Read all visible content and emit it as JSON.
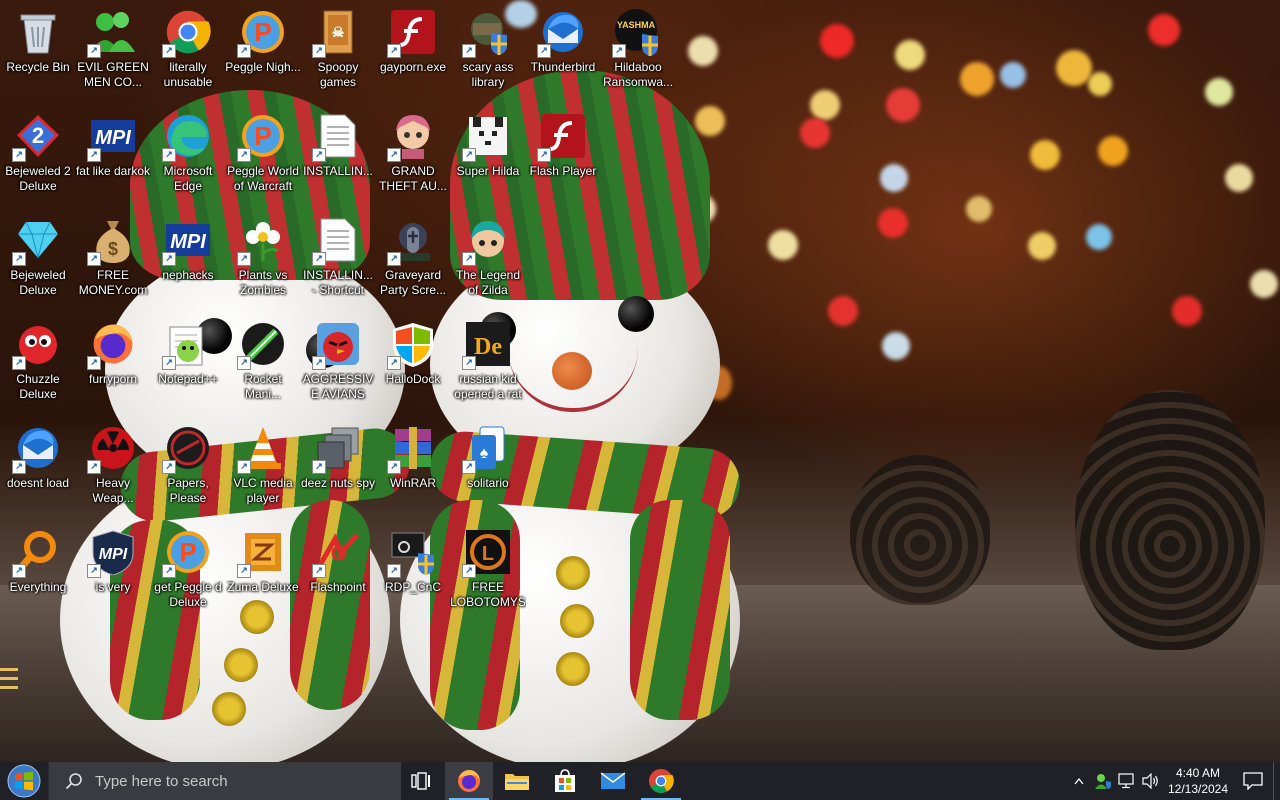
{
  "desktop": {
    "icons": [
      {
        "label": "Recycle Bin",
        "icon": "recycle-bin-icon"
      },
      {
        "label": "EVIL GREEN MEN CO...",
        "icon": "evil-green-men-icon"
      },
      {
        "label": "literally unusable",
        "icon": "chrome-icon"
      },
      {
        "label": "Peggle Nigh...",
        "icon": "peggle-icon"
      },
      {
        "label": "Spoopy games",
        "icon": "folder-icon"
      },
      {
        "label": "gayporn.exe",
        "icon": "flash-icon"
      },
      {
        "label": "scary ass library",
        "icon": "library-icon"
      },
      {
        "label": "Thunderbird",
        "icon": "thunderbird-icon"
      },
      {
        "label": "Hildaboo Ransomwa...",
        "icon": "yashma-icon"
      },
      {
        "label": "Bejeweled 2 Deluxe",
        "icon": "bejeweled2-icon"
      },
      {
        "label": "fat like darkok",
        "icon": "mpi-icon"
      },
      {
        "label": "Microsoft Edge",
        "icon": "edge-icon"
      },
      {
        "label": "Peggle World of Warcraft",
        "icon": "peggle-icon"
      },
      {
        "label": "INSTALLIN...",
        "icon": "document-icon"
      },
      {
        "label": "GRAND THEFT AU...",
        "icon": "anime-girl-icon"
      },
      {
        "label": "Super Hilda",
        "icon": "pixel-dog-icon"
      },
      {
        "label": "Flash Player",
        "icon": "flash-icon"
      },
      {
        "label": "Bejeweled Deluxe",
        "icon": "diamond-icon"
      },
      {
        "label": "FREE MONEY.com",
        "icon": "money-bag-icon"
      },
      {
        "label": "nephacks",
        "icon": "mpi-icon"
      },
      {
        "label": "Plants vs Zombies",
        "icon": "flower-icon"
      },
      {
        "label": "INSTALLIN... - Shortcut",
        "icon": "document-icon"
      },
      {
        "label": "Graveyard Party Scre...",
        "icon": "graveyard-icon"
      },
      {
        "label": "The Legend of Zilda",
        "icon": "zilda-icon"
      },
      {
        "label": "Chuzzle Deluxe",
        "icon": "chuzzle-icon"
      },
      {
        "label": "furryporn",
        "icon": "firefox-icon"
      },
      {
        "label": "Notepad++",
        "icon": "notepad-plus-icon"
      },
      {
        "label": "Rocket Mani...",
        "icon": "rocket-icon"
      },
      {
        "label": "AGGRESSIVE AVIANS",
        "icon": "angry-bird-icon"
      },
      {
        "label": "HalloDock",
        "icon": "windows-shield-icon"
      },
      {
        "label": "russian kid opened a rat",
        "icon": "de-icon"
      },
      {
        "label": "doesnt load",
        "icon": "thunderbird-icon"
      },
      {
        "label": "Heavy Weap...",
        "icon": "radiation-icon"
      },
      {
        "label": "Papers, Please",
        "icon": "papers-please-icon"
      },
      {
        "label": "VLC media player",
        "icon": "vlc-icon"
      },
      {
        "label": "deez nuts spy",
        "icon": "stacked-windows-icon"
      },
      {
        "label": "WinRAR",
        "icon": "winrar-icon"
      },
      {
        "label": "solitario",
        "icon": "solitaire-icon"
      },
      {
        "label": "Everything",
        "icon": "magnifier-icon"
      },
      {
        "label": "is very",
        "icon": "mpi-shield-icon"
      },
      {
        "label": "get Peggle d Deluxe",
        "icon": "peggle-icon"
      },
      {
        "label": "Zuma Deluxe",
        "icon": "zuma-icon"
      },
      {
        "label": "Flashpoint",
        "icon": "flashpoint-icon"
      },
      {
        "label": "RDP_CnC",
        "icon": "rdp-shield-icon"
      },
      {
        "label": "FREE LOBOTOMYS",
        "icon": "lobotomy-icon"
      }
    ]
  },
  "taskbar": {
    "search_placeholder": "Type here to search",
    "apps": [
      {
        "name": "task-view",
        "icon": "task-view-icon"
      },
      {
        "name": "firefox",
        "icon": "firefox-icon",
        "open": true,
        "active": true
      },
      {
        "name": "file-explorer",
        "icon": "folder-icon"
      },
      {
        "name": "microsoft-store",
        "icon": "store-icon"
      },
      {
        "name": "mail",
        "icon": "mail-icon"
      },
      {
        "name": "chrome",
        "icon": "chrome-icon",
        "open": true
      }
    ],
    "tray": {
      "time": "4:40 AM",
      "date": "12/13/2024",
      "icons": [
        "chevron-up-icon",
        "user-shield-icon",
        "network-icon",
        "volume-icon"
      ]
    }
  },
  "colors": {
    "taskbar_bg": "#202127",
    "search_bg": "#3a3b40",
    "accent": "#76b9ed"
  }
}
